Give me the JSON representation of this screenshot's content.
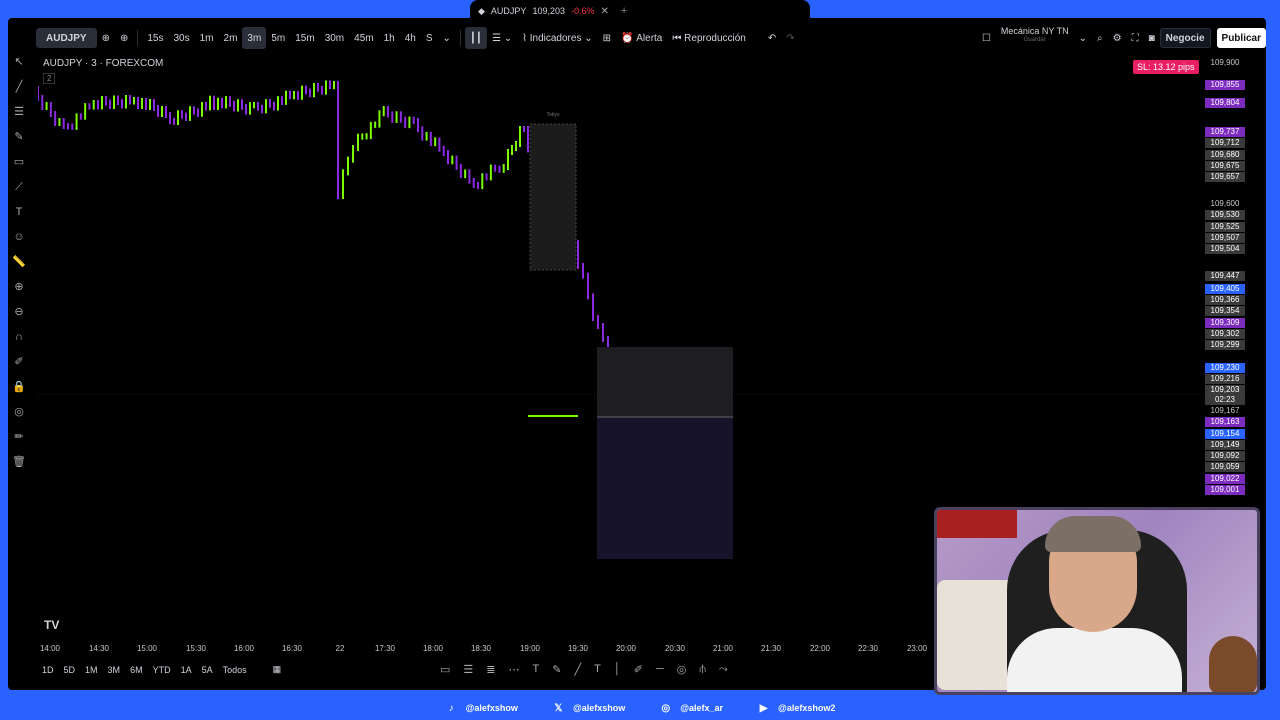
{
  "browser_tab": {
    "symbol": "AUDJPY",
    "price": "109,203",
    "change": "-0.6%"
  },
  "toolbar": {
    "symbol": "AUDJPY",
    "intervals": [
      "15s",
      "30s",
      "1m",
      "2m",
      "3m",
      "5m",
      "15m",
      "30m",
      "45m",
      "1h",
      "4h",
      "S"
    ],
    "active_interval": "3m",
    "indicators": "Indicadores",
    "alert": "Alerta",
    "replay": "Reproducción",
    "layout_name": "Mecánica NY TN",
    "layout_sub": "Guardar",
    "trade": "Negocie",
    "publish": "Publicar"
  },
  "legend": {
    "title": "AUDJPY · 3 · FOREXCOM",
    "sub": "2"
  },
  "sl_badge": "SL: 13.12 pips",
  "zone_label": "Tokyo",
  "price_labels": [
    {
      "v": "109,900",
      "style": "plain"
    },
    {
      "v": "109,855",
      "style": "purple"
    },
    {
      "v": "109,804",
      "style": "purple"
    },
    {
      "v": "109,737",
      "style": "purple"
    },
    {
      "v": "109,712",
      "style": "gray"
    },
    {
      "v": "109,680",
      "style": "gray"
    },
    {
      "v": "109,675",
      "style": "gray"
    },
    {
      "v": "109,657",
      "style": "gray"
    },
    {
      "v": "109,600",
      "style": "plain"
    },
    {
      "v": "109,530",
      "style": "gray"
    },
    {
      "v": "109,525",
      "style": "gray"
    },
    {
      "v": "109,507",
      "style": "gray"
    },
    {
      "v": "109,504",
      "style": "gray"
    },
    {
      "v": "109,447",
      "style": "gray"
    },
    {
      "v": "109,405",
      "style": "blue"
    },
    {
      "v": "109,366",
      "style": "gray"
    },
    {
      "v": "109,354",
      "style": "gray"
    },
    {
      "v": "109,309",
      "style": "purple"
    },
    {
      "v": "109,302",
      "style": "gray"
    },
    {
      "v": "109,299",
      "style": "gray"
    },
    {
      "v": "109,230",
      "style": "blue"
    },
    {
      "v": "109,216",
      "style": "gray"
    },
    {
      "v": "109,203",
      "style": "gray"
    },
    {
      "v": "02:23",
      "style": "gray"
    },
    {
      "v": "109,167",
      "style": "plain"
    },
    {
      "v": "109,163",
      "style": "purple"
    },
    {
      "v": "109,154",
      "style": "blue"
    },
    {
      "v": "109,149",
      "style": "gray"
    },
    {
      "v": "109,092",
      "style": "gray"
    },
    {
      "v": "109,059",
      "style": "gray"
    },
    {
      "v": "109,022",
      "style": "purple"
    },
    {
      "v": "109,001",
      "style": "purple"
    }
  ],
  "time_labels": [
    "14:00",
    "14:30",
    "15:00",
    "15:30",
    "16:00",
    "16:30",
    "22",
    "17:30",
    "18:00",
    "18:30",
    "19:00",
    "19:30",
    "20:00",
    "20:30",
    "21:00",
    "21:30",
    "22:00",
    "22:30",
    "23:00"
  ],
  "bottom_ranges": [
    "1D",
    "5D",
    "1M",
    "3M",
    "6M",
    "YTD",
    "1A",
    "5A",
    "Todos"
  ],
  "social": [
    {
      "icon": "tiktok-icon",
      "handle": "@alefxshow"
    },
    {
      "icon": "x-icon",
      "handle": "@alefxshow"
    },
    {
      "icon": "instagram-icon",
      "handle": "@alefx_ar"
    },
    {
      "icon": "youtube-icon",
      "handle": "@alefxshow2"
    }
  ],
  "colors": {
    "bull": "#7cfc00",
    "bear": "#8a2be2",
    "accent": "#2962ff",
    "sl": "#e91e63"
  }
}
